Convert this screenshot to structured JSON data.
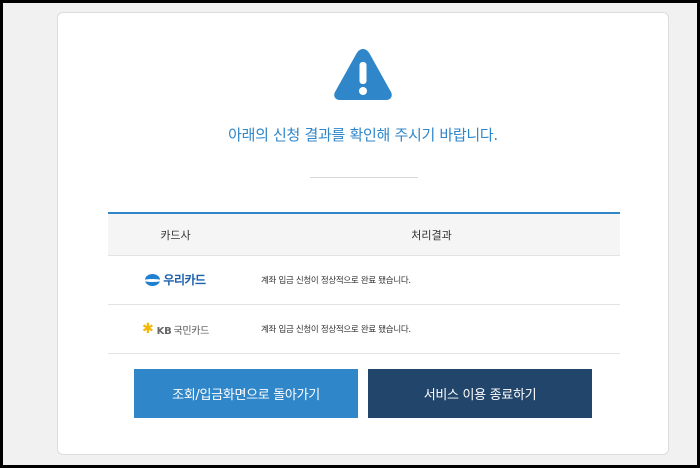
{
  "message": "아래의 신청 결과를 확인해 주시기 바랍니다.",
  "table": {
    "headers": {
      "card_company": "카드사",
      "result": "처리결과"
    },
    "rows": [
      {
        "card_logo_text": "우리카드",
        "result": "계좌 입금 신청이 정상적으로 완료 됐습니다."
      },
      {
        "card_logo_brand": "KB",
        "card_logo_text": "국민카드",
        "result": "계좌 입금 신청이 정상적으로 완료 됐습니다."
      }
    ]
  },
  "buttons": {
    "back": "조회/입금화면으로 돌아가기",
    "exit": "서비스 이용 종료하기"
  },
  "colors": {
    "accent": "#2f86c9",
    "dark_button": "#22456b",
    "woori_blue": "#1b5fae",
    "kb_yellow": "#f2b705"
  },
  "icons": {
    "status": "warning-icon",
    "woori": "woori-logo",
    "kb": "kb-star-logo"
  }
}
